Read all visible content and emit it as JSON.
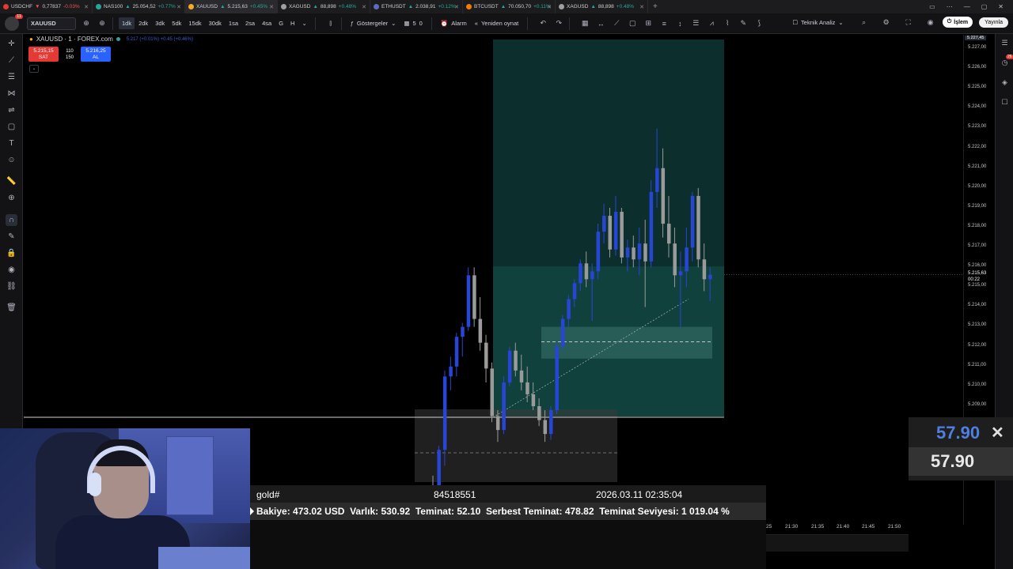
{
  "browser_tabs": [
    {
      "symbol": "USDCHF",
      "price": "0,77837",
      "change": "-0.03%",
      "neg": true,
      "color": "#e53935",
      "active": false
    },
    {
      "symbol": "NAS100",
      "price": "25.054,52",
      "change": "+0.77%",
      "neg": false,
      "color": "#26a69a",
      "active": false
    },
    {
      "symbol": "XAUUSD",
      "price": "5.215,63",
      "change": "+0.45%",
      "neg": false,
      "color": "#f9a825",
      "active": true
    },
    {
      "symbol": "XAGUSD",
      "price": "88,898",
      "change": "+0.48%",
      "neg": false,
      "color": "#9e9e9e",
      "active": false
    },
    {
      "symbol": "ETHUSDT",
      "price": "2.038,91",
      "change": "+0.12%",
      "neg": false,
      "color": "#5c6bc0",
      "active": false
    },
    {
      "symbol": "BTCUSDT",
      "price": "70.050,70",
      "change": "+0.11%",
      "neg": false,
      "color": "#f57c00",
      "active": false
    },
    {
      "symbol": "XAGUSD",
      "price": "88,898",
      "change": "+0.48%",
      "neg": false,
      "color": "#9e9e9e",
      "active": false
    }
  ],
  "toolbar": {
    "notif_count": "11",
    "symbol": "XAUUSD",
    "timeframes": [
      "1dk",
      "2dk",
      "3dk",
      "5dk",
      "15dk",
      "30dk",
      "1sa",
      "2sa",
      "4sa",
      "G",
      "H"
    ],
    "selected_timeframe": "1dk",
    "indicators_label": "Göstergeler",
    "alert_label": "Alarm",
    "replay_label": "Yeniden oynat",
    "count_a": "5",
    "count_b": "0",
    "technical_label": "Teknik Analiz",
    "trade_label": "İşlem",
    "publish_label": "Yayınla"
  },
  "legend": {
    "title": "XAUUSD · 1 · FOREX.com",
    "ohlc": "5.217 (+0.01%) +0.45 (+0.46%)"
  },
  "trade": {
    "sell_price": "5.215,15",
    "sell_label": "SAT",
    "buy_price": "5.216,25",
    "buy_label": "AL",
    "spread": "110",
    "lot": "150"
  },
  "right_panel": {
    "badge": "26"
  },
  "price_axis": {
    "top_label": "5.227,45",
    "ticks": [
      "5.227,00",
      "5.226,00",
      "5.225,00",
      "5.224,00",
      "5.223,00",
      "5.222,00",
      "5.221,00",
      "5.220,00",
      "5.219,00",
      "5.218,00",
      "5.217,00",
      "5.216,00",
      "5.215,00",
      "5.214,00",
      "5.213,00",
      "5.212,00",
      "5.211,00",
      "5.210,00",
      "5.209,00"
    ],
    "current_price": "5.215,63",
    "current_time": "00:22"
  },
  "mt_panel": {
    "symbol": "gold#",
    "ticket": "84518551",
    "datetime": "2026.03.11 02:35:04",
    "balance_label": "Bakiye:",
    "balance": "473.02 USD",
    "equity_label": "Varlık:",
    "equity": "530.92",
    "margin_label": "Teminat:",
    "margin": "52.10",
    "free_margin_label": "Serbest Teminat:",
    "free_margin": "478.82",
    "margin_level_label": "Teminat Seviyesi:",
    "margin_level": "1 019.04 %"
  },
  "time_axis": [
    "25",
    "21:30",
    "21:35",
    "21:40",
    "21:45",
    "21:50"
  ],
  "lot_panel": {
    "value_top": "57.90",
    "value_bottom": "57.90",
    "close": "✕"
  },
  "colors": {
    "bull": "#2846d6",
    "bear": "#9a9a9a",
    "teal_zone": "#0f3b38",
    "teal_profit": "#1c6d66",
    "accent_blue": "#2962ff",
    "sell_red": "#e53935"
  }
}
